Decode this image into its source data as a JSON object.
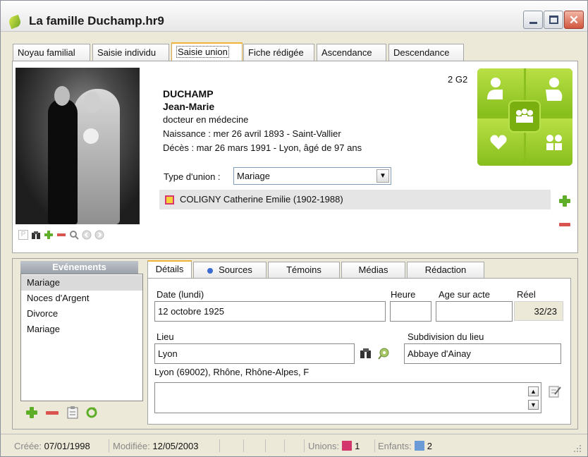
{
  "window": {
    "title": "La famille Duchamp.hr9",
    "close_glyph": "✕"
  },
  "tabs": [
    {
      "label": "Noyau familial"
    },
    {
      "label": "Saisie individu"
    },
    {
      "label": "Saisie union"
    },
    {
      "label": "Fiche rédigée"
    },
    {
      "label": "Ascendance"
    },
    {
      "label": "Descendance"
    }
  ],
  "person": {
    "surname": "DUCHAMP",
    "firstname": "Jean-Marie",
    "occupation": "docteur en médecine",
    "birth": "Naissance : mer 26 avril 1893 - Saint-Vallier",
    "death": "Décès : mar 26 mars 1991 - Lyon, âgé de 97 ans",
    "generation_code": "2 G2"
  },
  "union": {
    "type_label": "Type d'union :",
    "type_value": "Mariage",
    "spouse": "COLIGNY Catherine Emilie (1902-1988)",
    "spouse_flag_color": "#f5d23a"
  },
  "photo_tools": {
    "p_label": "P"
  },
  "events": {
    "header": "Evénements",
    "items": [
      "Mariage",
      "Noces d'Argent",
      "Divorce",
      "Mariage"
    ]
  },
  "detail_tabs": [
    {
      "label": "Détails"
    },
    {
      "label": "Sources"
    },
    {
      "label": "Témoins"
    },
    {
      "label": "Médias"
    },
    {
      "label": "Rédaction"
    }
  ],
  "details": {
    "date_label": "Date (lundi)",
    "date_value": "12 octobre 1925",
    "time_label": "Heure",
    "time_value": "",
    "age_label": "Age sur acte",
    "age_value": "",
    "real_label": "Réel",
    "real_value": "32/23",
    "place_label": "Lieu",
    "place_value": "Lyon",
    "subdivision_label": "Subdivision du lieu",
    "subdivision_value": "Abbaye d'Ainay",
    "place_full": "Lyon (69002), Rhône, Rhône-Alpes, F",
    "memo": ""
  },
  "status": {
    "created_label": "Créée:",
    "created_value": "07/01/1998",
    "modified_label": "Modifiée:",
    "modified_value": "12/05/2003",
    "unions_label": "Unions:",
    "unions_count": "1",
    "unions_color": "#d4376b",
    "children_label": "Enfants:",
    "children_count": "2",
    "children_color": "#6b9bd6"
  },
  "accent_color": "#8bbf1d"
}
